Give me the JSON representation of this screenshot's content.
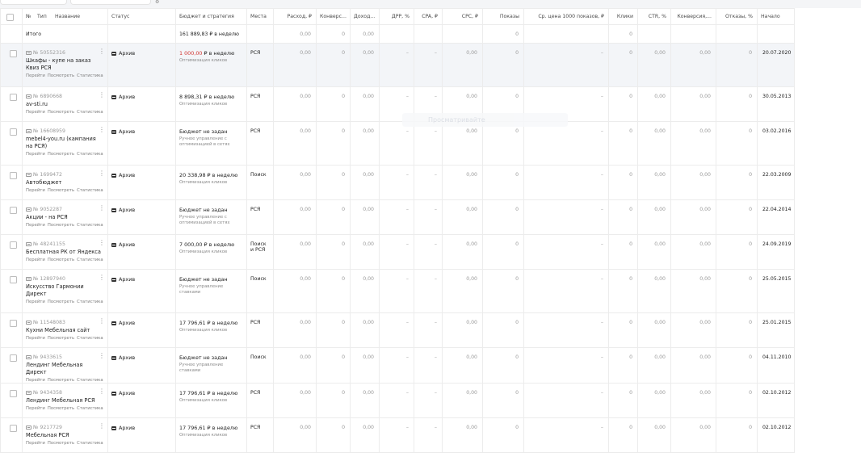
{
  "header": {
    "no": "№",
    "type": "Тип",
    "name": "Название",
    "status": "Статус",
    "budget": "Бюджет и стратегия",
    "places": "Места",
    "spend": "Расход, ₽",
    "conv": "Конверс...",
    "income": "Доход...",
    "drr": "ДРР, %",
    "cpa": "CPA, ₽",
    "cpc": "CPC, ₽",
    "shows": "Показы",
    "cpm": "Ср. цена 1000 показов, ₽",
    "clicks": "Клики",
    "ctr": "CTR, %",
    "convrate": "Конверсия,...",
    "bounce": "Отказы, %",
    "start": "Начало"
  },
  "total": {
    "label": "Итого",
    "budget": "161 889,83 ₽ в неделю",
    "spend": "0,00",
    "conv": "0",
    "income": "0,00",
    "shows": "0",
    "clicks": "0"
  },
  "link_labels": {
    "go": "Перейти",
    "view": "Посмотреть",
    "stats": "Статистика"
  },
  "overlay_text": "Просматривайте",
  "rows": [
    {
      "id": "№ 50552316",
      "name": "Шкафы - купе на заказ Квиз РСЯ",
      "status": "Архив",
      "budget": "1 000,00 ₽ в неделю",
      "budget_red": "1 000,00",
      "strategy": "Оптимизация кликов",
      "places": "РСЯ",
      "spend": "0,00",
      "conv": "0",
      "income": "0,00",
      "drr": "–",
      "cpa": "–",
      "cpc": "0,00",
      "shows": "0",
      "cpm": "–",
      "clicks": "0",
      "ctr": "0,00",
      "convrate": "0,00",
      "bounce": "0",
      "start": "20.07.2020",
      "hl": true
    },
    {
      "id": "№ 6890668",
      "name": "av-sti.ru",
      "status": "Архив",
      "budget": "8 898,31 ₽ в неделю",
      "strategy": "Оптимизация кликов",
      "places": "РСЯ",
      "spend": "0,00",
      "conv": "0",
      "income": "0,00",
      "drr": "–",
      "cpa": "–",
      "cpc": "0,00",
      "shows": "0",
      "cpm": "–",
      "clicks": "0",
      "ctr": "0,00",
      "convrate": "0,00",
      "bounce": "0",
      "start": "30.05.2013"
    },
    {
      "id": "№ 16608959",
      "name": "mebel4-you.ru (кампания на РСЯ)",
      "status": "Архив",
      "budget": "Бюджет не задан",
      "strategy": "Ручное управление с оптимизацией в сетях",
      "places": "РСЯ",
      "spend": "0,00",
      "conv": "0",
      "income": "0,00",
      "drr": "–",
      "cpa": "–",
      "cpc": "0,00",
      "shows": "0",
      "cpm": "–",
      "clicks": "0",
      "ctr": "0,00",
      "convrate": "0,00",
      "bounce": "0",
      "start": "03.02.2016"
    },
    {
      "id": "№ 1699472",
      "name": "Автобюджет",
      "status": "Архив",
      "budget": "20 338,98 ₽ в неделю",
      "strategy": "Оптимизация кликов",
      "places": "Поиск",
      "spend": "0,00",
      "conv": "0",
      "income": "0,00",
      "drr": "–",
      "cpa": "–",
      "cpc": "0,00",
      "shows": "0",
      "cpm": "–",
      "clicks": "0",
      "ctr": "0,00",
      "convrate": "0,00",
      "bounce": "0",
      "start": "22.03.2009"
    },
    {
      "id": "№ 9052287",
      "name": "Акции - на РСЯ",
      "status": "Архив",
      "budget": "Бюджет не задан",
      "strategy": "Ручное управление с оптимизацией в сетях",
      "places": "РСЯ",
      "spend": "0,00",
      "conv": "0",
      "income": "0,00",
      "drr": "–",
      "cpa": "–",
      "cpc": "0,00",
      "shows": "0",
      "cpm": "–",
      "clicks": "0",
      "ctr": "0,00",
      "convrate": "0,00",
      "bounce": "0",
      "start": "22.04.2014"
    },
    {
      "id": "№ 48241155",
      "name": "Бесплатная РК от Яндекса",
      "status": "Архив",
      "budget": "7 000,00 ₽ в неделю",
      "strategy": "Оптимизация кликов",
      "places": "Поиск и РСЯ",
      "spend": "0,00",
      "conv": "0",
      "income": "0,00",
      "drr": "–",
      "cpa": "–",
      "cpc": "0,00",
      "shows": "0",
      "cpm": "–",
      "clicks": "0",
      "ctr": "0,00",
      "convrate": "0,00",
      "bounce": "0",
      "start": "24.09.2019"
    },
    {
      "id": "№ 12897940",
      "name": "Искусство Гармонии Директ",
      "status": "Архив",
      "budget": "Бюджет не задан",
      "strategy": "Ручное управление ставками",
      "places": "Поиск",
      "spend": "0,00",
      "conv": "0",
      "income": "0,00",
      "drr": "–",
      "cpa": "–",
      "cpc": "0,00",
      "shows": "0",
      "cpm": "–",
      "clicks": "0",
      "ctr": "0,00",
      "convrate": "0,00",
      "bounce": "0",
      "start": "25.05.2015"
    },
    {
      "id": "№ 11548083",
      "name": "Кухни Мебельная сайт",
      "status": "Архив",
      "budget": "17 796,61 ₽ в неделю",
      "strategy": "Оптимизация кликов",
      "places": "РСЯ",
      "spend": "0,00",
      "conv": "0",
      "income": "0,00",
      "drr": "–",
      "cpa": "–",
      "cpc": "0,00",
      "shows": "0",
      "cpm": "–",
      "clicks": "0",
      "ctr": "0,00",
      "convrate": "0,00",
      "bounce": "0",
      "start": "25.01.2015"
    },
    {
      "id": "№ 9433615",
      "name": "Лендинг Мебельная Директ",
      "status": "Архив",
      "budget": "Бюджет не задан",
      "strategy": "Ручное управление ставками",
      "places": "Поиск",
      "spend": "0,00",
      "conv": "0",
      "income": "0,00",
      "drr": "–",
      "cpa": "–",
      "cpc": "0,00",
      "shows": "0",
      "cpm": "–",
      "clicks": "0",
      "ctr": "0,00",
      "convrate": "0,00",
      "bounce": "0",
      "start": "04.11.2010"
    },
    {
      "id": "№ 9434358",
      "name": "Лендинг Мебельная РСЯ",
      "status": "Архив",
      "budget": "17 796,61 ₽ в неделю",
      "strategy": "Оптимизация кликов",
      "places": "РСЯ",
      "spend": "0,00",
      "conv": "0",
      "income": "0,00",
      "drr": "–",
      "cpa": "–",
      "cpc": "0,00",
      "shows": "0",
      "cpm": "–",
      "clicks": "0",
      "ctr": "0,00",
      "convrate": "0,00",
      "bounce": "0",
      "start": "02.10.2012"
    },
    {
      "id": "№ 9217729",
      "name": "Мебельная РСЯ",
      "status": "Архив",
      "budget": "17 796,61 ₽ в неделю",
      "strategy": "Оптимизация кликов",
      "places": "РСЯ",
      "spend": "0,00",
      "conv": "0",
      "income": "0,00",
      "drr": "–",
      "cpa": "–",
      "cpc": "0,00",
      "shows": "0",
      "cpm": "–",
      "clicks": "0",
      "ctr": "0,00",
      "convrate": "0,00",
      "bounce": "0",
      "start": "02.10.2012"
    }
  ]
}
